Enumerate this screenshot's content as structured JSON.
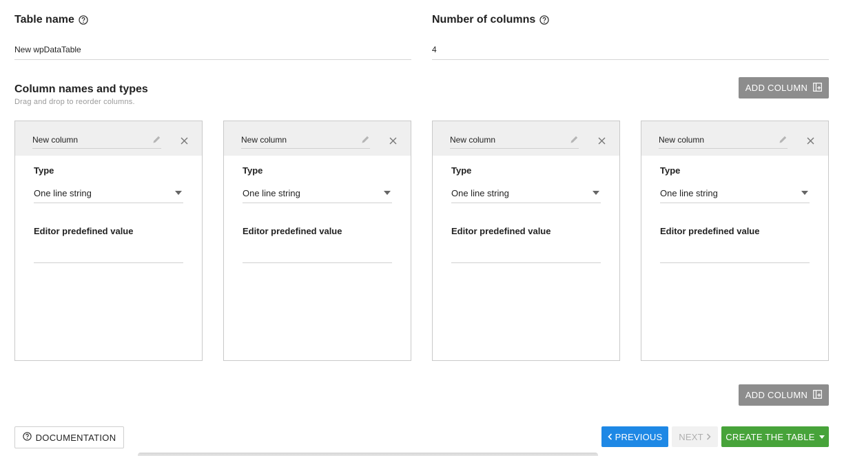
{
  "table_name": {
    "label": "Table name",
    "value": "New wpDataTable"
  },
  "num_columns": {
    "label": "Number of columns",
    "value": "4"
  },
  "columns_section": {
    "title": "Column names and types",
    "subtitle": "Drag and drop to reorder columns.",
    "add_column_label": "ADD COLUMN"
  },
  "columns": [
    {
      "name": "New column",
      "type_label": "Type",
      "type_value": "One line string",
      "predefined_label": "Editor predefined value",
      "predefined_value": ""
    },
    {
      "name": "New column",
      "type_label": "Type",
      "type_value": "One line string",
      "predefined_label": "Editor predefined value",
      "predefined_value": ""
    },
    {
      "name": "New column",
      "type_label": "Type",
      "type_value": "One line string",
      "predefined_label": "Editor predefined value",
      "predefined_value": ""
    },
    {
      "name": "New column",
      "type_label": "Type",
      "type_value": "One line string",
      "predefined_label": "Editor predefined value",
      "predefined_value": ""
    }
  ],
  "footer": {
    "documentation": "DOCUMENTATION",
    "previous": "PREVIOUS",
    "next": "NEXT",
    "create": "CREATE THE TABLE"
  },
  "colors": {
    "primary_blue": "#1e88e5",
    "success_green": "#47a33a",
    "button_gray": "#8d8d8d",
    "card_header": "#efefef"
  }
}
